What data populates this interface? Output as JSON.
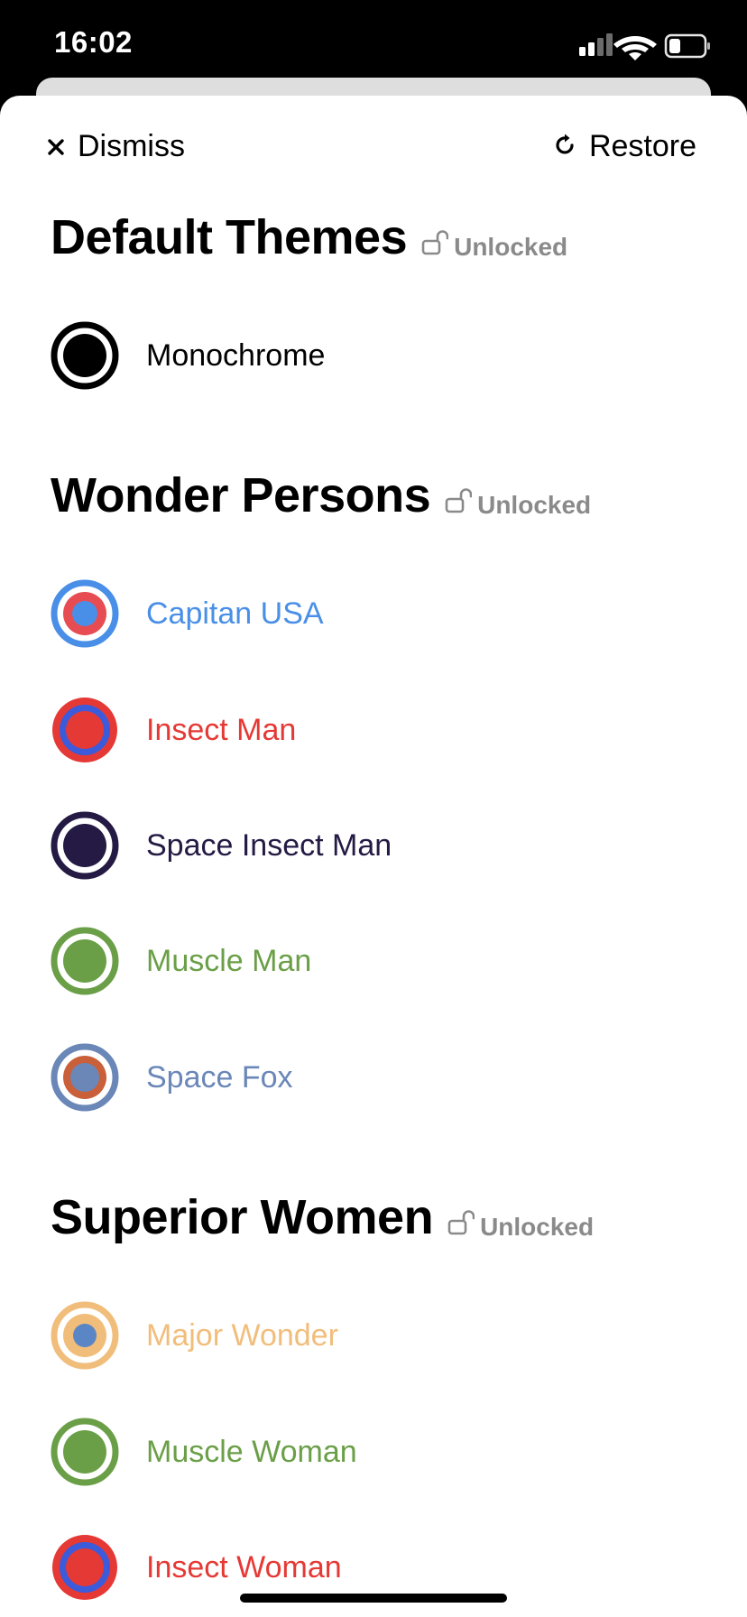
{
  "status_bar": {
    "time": "16:02"
  },
  "nav": {
    "dismiss_label": "Dismiss",
    "restore_label": "Restore"
  },
  "sections": [
    {
      "title": "Default Themes",
      "status": "Unlocked",
      "themes": [
        {
          "name": "Monochrome",
          "outer": "#000000",
          "inner": "#000000",
          "text": "#000000"
        }
      ]
    },
    {
      "title": "Wonder Persons",
      "status": "Unlocked",
      "themes": [
        {
          "name": "Capitan USA",
          "outer": "#4a8fe7",
          "inner": "#e74c52",
          "text": "#4a8fe7",
          "dot": "#4a8fe7"
        },
        {
          "name": "Insect Man",
          "outer": "#e53935",
          "inner": "#3b5bdb",
          "text": "#e53935",
          "dot": "#e53935"
        },
        {
          "name": "Space Insect Man",
          "outer": "#241a44",
          "inner": "#241a44",
          "text": "#241a44"
        },
        {
          "name": "Muscle Man",
          "outer": "#6a9f47",
          "inner": "#6a9f47",
          "text": "#6a9f47"
        },
        {
          "name": "Space Fox",
          "outer": "#6a87b8",
          "inner": "#c9603a",
          "text": "#6a87b8",
          "dot": "#6a87b8"
        }
      ]
    },
    {
      "title": "Superior Women",
      "status": "Unlocked",
      "themes": [
        {
          "name": "Major Wonder",
          "outer": "#f1bd7b",
          "inner": "#f1bd7b",
          "text": "#f1bd7b",
          "dot": "#5b86c6"
        },
        {
          "name": "Muscle Woman",
          "outer": "#6a9f47",
          "inner": "#6a9f47",
          "text": "#6a9f47"
        },
        {
          "name": "Insect Woman",
          "outer": "#e53935",
          "inner": "#3b5bdb",
          "text": "#e53935",
          "dot": "#e53935"
        }
      ]
    }
  ]
}
